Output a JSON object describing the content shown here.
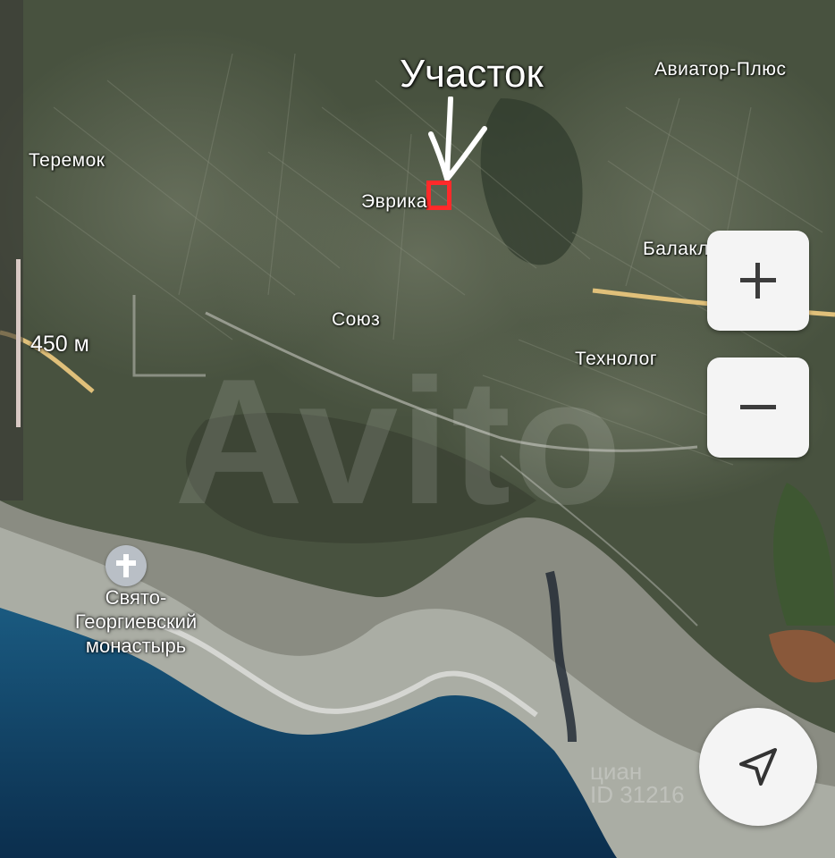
{
  "annotation": {
    "text": "Участок"
  },
  "places": {
    "teremok": "Теремок",
    "aviator": "Авиатор-Плюс",
    "evrika": "Эврика",
    "balaklavets": "Балаклавец",
    "soyuz": "Союз",
    "tekhnolog": "Технолог"
  },
  "poi": {
    "monastery_line1": "Свято-",
    "monastery_line2": "Георгиевский",
    "monastery_line3": "монастырь",
    "icon": "cross-icon"
  },
  "scale": {
    "label": "450 м"
  },
  "watermarks": {
    "avito": "Avito",
    "cian_line1": "циан",
    "cian_line2": "ID 31216"
  },
  "controls": {
    "zoom_in_icon": "plus-icon",
    "zoom_out_icon": "minus-icon",
    "locate_icon": "navigation-arrow-icon"
  },
  "colors": {
    "marker": "#ff2a2a",
    "road": "#e0c07a",
    "sea": "#0f3f66",
    "land": "#4a5440"
  }
}
